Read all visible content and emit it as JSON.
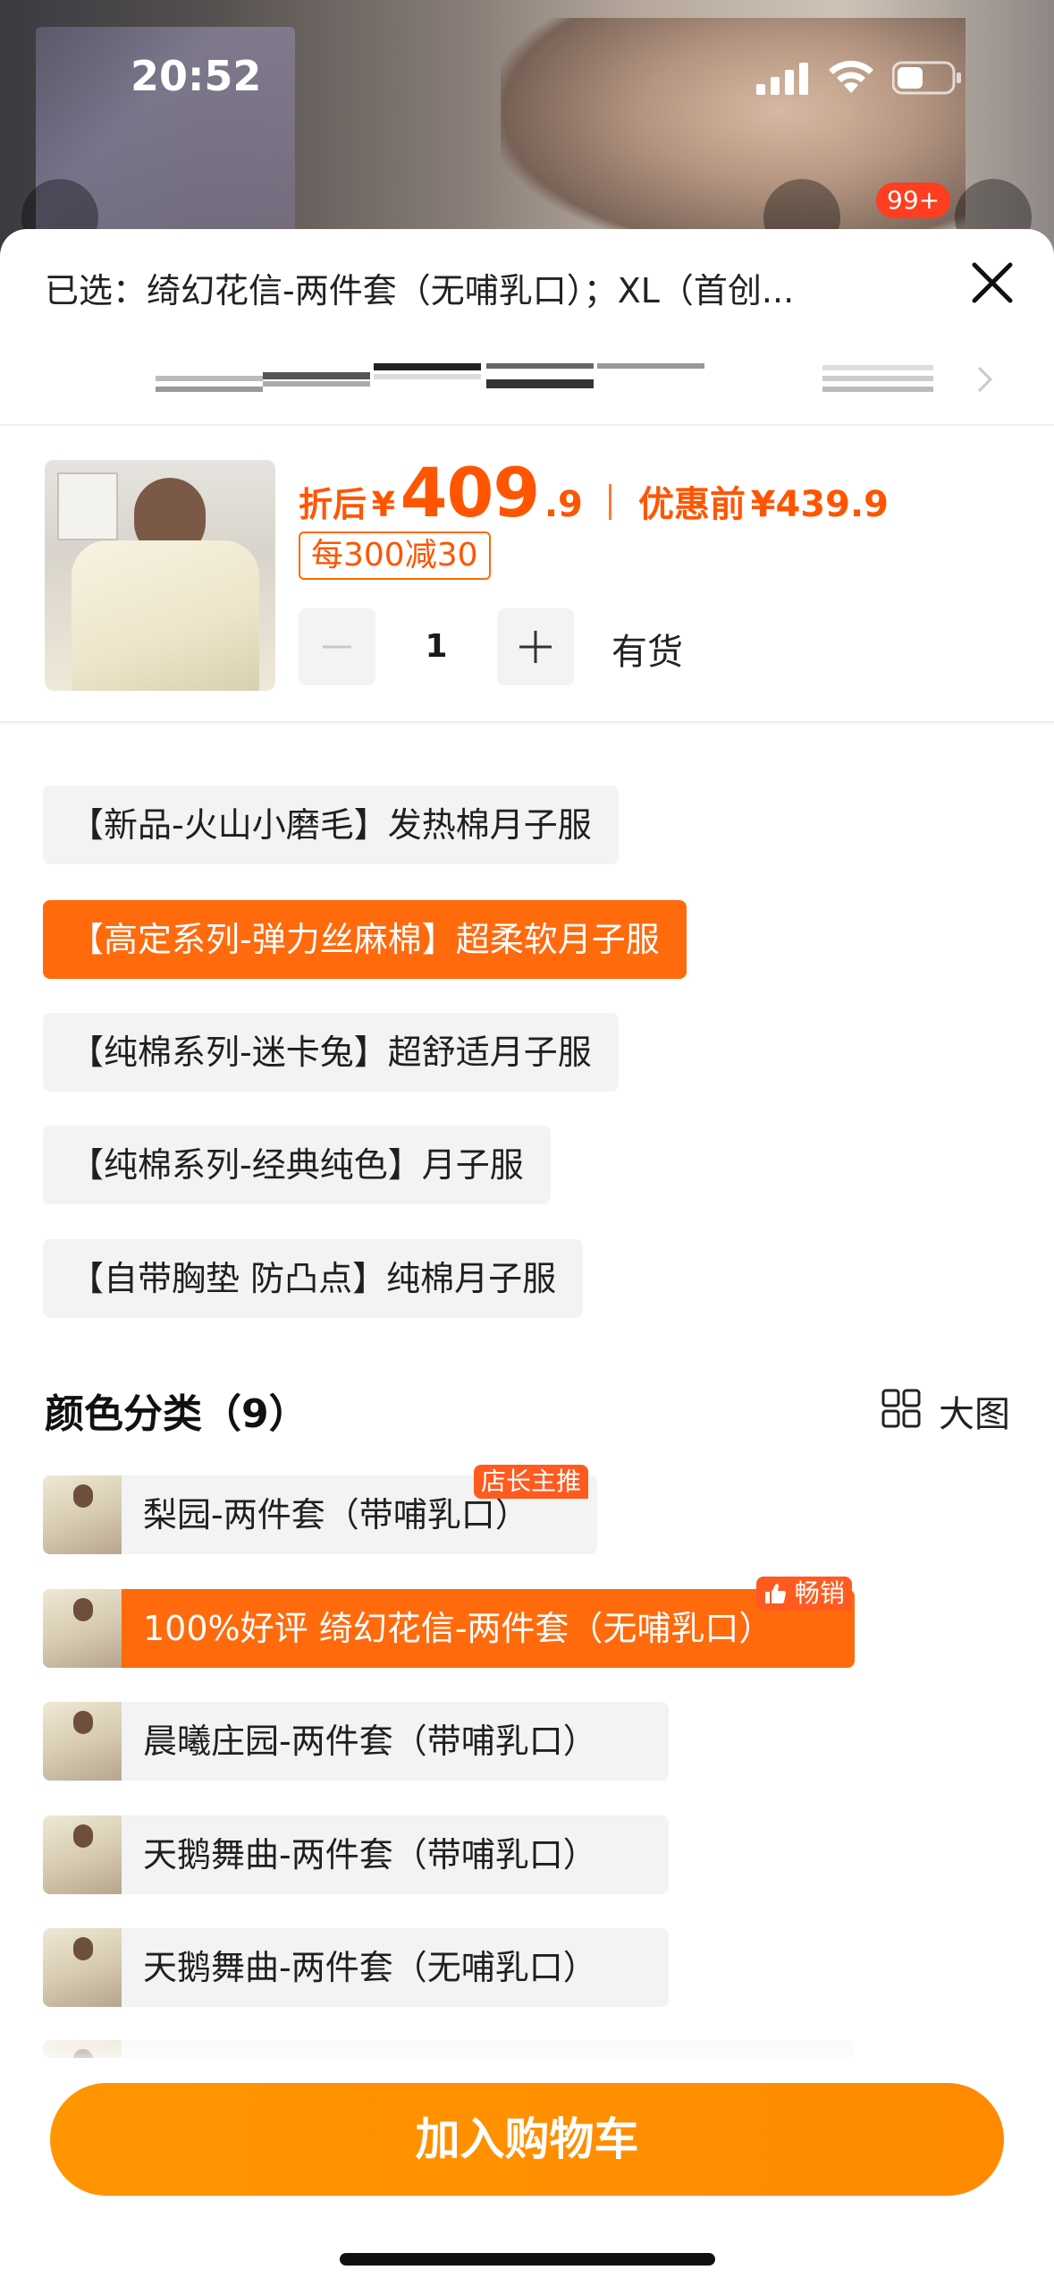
{
  "status_bar": {
    "time": "20:52"
  },
  "badge": {
    "cart_count": "99+"
  },
  "selected": {
    "label": "已选：绮幻花信-两件套（无哺乳口）；XL（首创..."
  },
  "price": {
    "after_label": "折后",
    "currency": "¥",
    "after_int": "409",
    "after_dec": ".9",
    "before_label": "优惠前",
    "before_value": "¥439.9",
    "promo": "每300减30"
  },
  "quantity": {
    "value": "1",
    "stock": "有货"
  },
  "style_options": [
    {
      "label": "【新品-火山小磨毛】发热棉月子服",
      "active": false
    },
    {
      "label": "【高定系列-弹力丝麻棉】超柔软月子服",
      "active": true
    },
    {
      "label": "【纯棉系列-迷卡兔】超舒适月子服",
      "active": false
    },
    {
      "label": "【纯棉系列-经典纯色】月子服",
      "active": false
    },
    {
      "label": "【自带胸垫 防凸点】纯棉月子服",
      "active": false
    }
  ],
  "color_section": {
    "title": "颜色分类（9）",
    "big_view": "大图",
    "items": [
      {
        "label": "梨园-两件套（带哺乳口）",
        "tag": "店长主推",
        "active": false
      },
      {
        "label": "100%好评  绮幻花信-两件套（无哺乳口）",
        "tag": "畅销",
        "active": true
      },
      {
        "label": "晨曦庄园-两件套（带哺乳口）",
        "tag": "",
        "active": false
      },
      {
        "label": "天鹅舞曲-两件套（带哺乳口）",
        "tag": "",
        "active": false
      },
      {
        "label": "天鹅舞曲-两件套（无哺乳口）",
        "tag": "",
        "active": false
      }
    ]
  },
  "cart_button": {
    "label": "加入购物车"
  },
  "colors": {
    "accent": "#ff6a0d",
    "price": "#ff5500",
    "button": "#ff9500"
  }
}
